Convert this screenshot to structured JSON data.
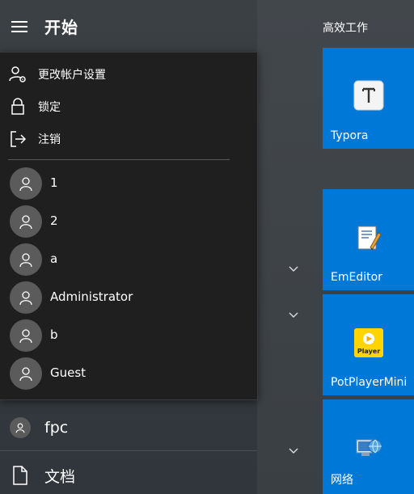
{
  "start": {
    "title": "开始"
  },
  "account_menu": {
    "items": [
      {
        "label": "更改帐户设置",
        "icon": "user-settings-icon"
      },
      {
        "label": "锁定",
        "icon": "lock-icon"
      },
      {
        "label": "注销",
        "icon": "sign-out-icon"
      }
    ],
    "users": [
      {
        "name": "1"
      },
      {
        "name": "2"
      },
      {
        "name": "a"
      },
      {
        "name": "Administrator"
      },
      {
        "name": "b"
      },
      {
        "name": "Guest"
      }
    ]
  },
  "current_user": {
    "name": "fpc"
  },
  "rail": {
    "documents_label": "文档"
  },
  "tiles": {
    "group_title": "高效工作",
    "items": [
      {
        "label": "Typora",
        "icon": "typora-icon",
        "color": "#0078d7"
      },
      {
        "label": "EmEditor",
        "icon": "emeditor-icon",
        "color": "#0078d7"
      },
      {
        "label": "PotPlayerMini",
        "icon": "potplayer-icon",
        "icon_text": "Player",
        "color": "#0078d7"
      },
      {
        "label": "网络",
        "icon": "network-icon",
        "color": "#0078d7"
      }
    ]
  },
  "colors": {
    "accent": "#0078d7",
    "menu_bg": "#1f1f1f",
    "avatar_bg": "#5b5b5b"
  }
}
